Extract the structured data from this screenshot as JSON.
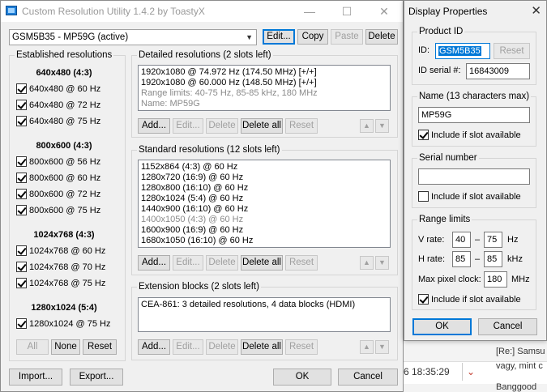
{
  "window": {
    "title": "Custom Resolution Utility 1.4.2 by ToastyX"
  },
  "monitor_select": {
    "value": "GSM5B35 - MP59G (active)"
  },
  "toolbar": {
    "edit": "Edit...",
    "copy": "Copy",
    "paste": "Paste",
    "delete": "Delete"
  },
  "established": {
    "label": "Established resolutions",
    "groups": [
      {
        "heading": "640x480 (4:3)",
        "items": [
          "640x480 @ 60 Hz",
          "640x480 @ 72 Hz",
          "640x480 @ 75 Hz"
        ]
      },
      {
        "heading": "800x600 (4:3)",
        "items": [
          "800x600 @ 56 Hz",
          "800x600 @ 60 Hz",
          "800x600 @ 72 Hz",
          "800x600 @ 75 Hz"
        ]
      },
      {
        "heading": "1024x768 (4:3)",
        "items": [
          "1024x768 @ 60 Hz",
          "1024x768 @ 70 Hz",
          "1024x768 @ 75 Hz"
        ]
      },
      {
        "heading": "1280x1024 (5:4)",
        "items": [
          "1280x1024 @ 75 Hz"
        ]
      }
    ],
    "buttons": {
      "all": "All",
      "none": "None",
      "reset": "Reset"
    }
  },
  "detailed": {
    "label": "Detailed resolutions (2 slots left)",
    "rows": [
      "1920x1080 @ 74.972 Hz (174.50 MHz) [+/+]",
      "1920x1080 @ 60.000 Hz (148.50 MHz) [+/+]"
    ],
    "info": [
      "Range limits: 40-75 Hz, 85-85 kHz, 180 MHz",
      "Name: MP59G"
    ]
  },
  "standard": {
    "label": "Standard resolutions (12 slots left)",
    "rows": [
      "1152x864 (4:3) @ 60 Hz",
      "1280x720 (16:9) @ 60 Hz",
      "1280x800 (16:10) @ 60 Hz",
      "1280x1024 (5:4) @ 60 Hz",
      "1440x900 (16:10) @ 60 Hz",
      "1400x1050 (4:3) @ 60 Hz",
      "1600x900 (16:9) @ 60 Hz",
      "1680x1050 (16:10) @ 60 Hz"
    ]
  },
  "extension": {
    "label": "Extension blocks (2 slots left)",
    "rows": [
      "CEA-861: 3 detailed resolutions, 4 data blocks (HDMI)"
    ]
  },
  "list_buttons": {
    "add": "Add...",
    "edit": "Edit...",
    "delete": "Delete",
    "delete_all": "Delete all",
    "reset": "Reset"
  },
  "footer": {
    "import": "Import...",
    "export": "Export...",
    "ok": "OK",
    "cancel": "Cancel"
  },
  "dialog": {
    "title": "Display Properties",
    "product_id": {
      "label": "Product ID",
      "id_label": "ID:",
      "id_value": "GSM5B35",
      "reset": "Reset",
      "serial_label": "ID serial #:",
      "serial_value": "16843009"
    },
    "name": {
      "label": "Name (13 characters max)",
      "value": "MP59G",
      "include": "Include if slot available"
    },
    "serial": {
      "label": "Serial number",
      "value": "",
      "include": "Include if slot available"
    },
    "range": {
      "label": "Range limits",
      "v_label": "V rate:",
      "v_min": "40",
      "v_max": "75",
      "v_unit": "Hz",
      "h_label": "H rate:",
      "h_min": "85",
      "h_max": "85",
      "h_unit": "kHz",
      "pclk_label": "Max pixel clock:",
      "pclk_value": "180",
      "pclk_unit": "MHz",
      "dash": "–",
      "include": "Include if slot available"
    },
    "ok": "OK",
    "cancel": "Cancel"
  },
  "background": {
    "timestamp": "6 18:35:29",
    "row1": "[Re:] Samsu",
    "row2": "vagy, mint c",
    "row3": "Banggood"
  }
}
